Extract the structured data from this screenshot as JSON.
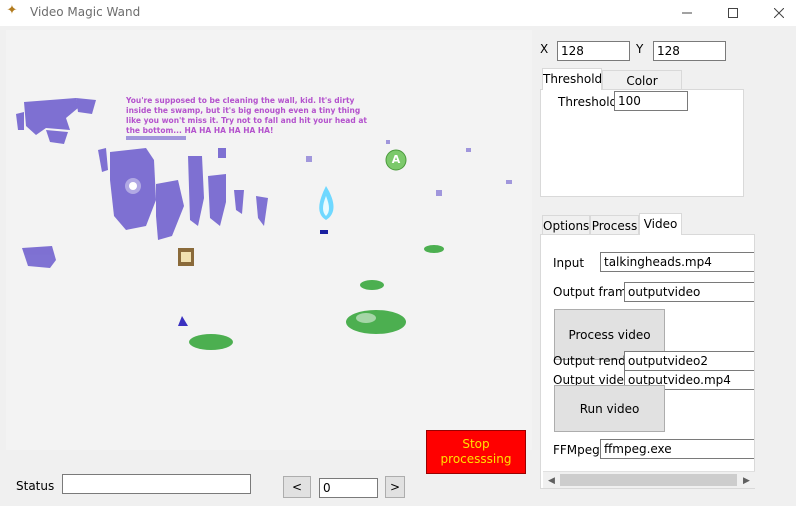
{
  "window": {
    "title": "Video Magic Wand"
  },
  "scene": {
    "speech_text": "You're supposed to be cleaning the wall, kid. It's dirty inside the swamp, but it's big enough even a tiny thing like you won't miss it. Try not to fall and hit your head at the bottom... HA HA HA HA HA HA!",
    "badge_letter": "A"
  },
  "coords": {
    "x_label": "X",
    "x_value": "128",
    "y_label": "Y",
    "y_value": "128"
  },
  "threshold_tabs": {
    "tab1": "Threshold",
    "tab2": "Color threshold",
    "field_label": "Threshold",
    "field_value": "100"
  },
  "options_tabs": {
    "tab1": "Options",
    "tab2": "Process",
    "tab3": "Video"
  },
  "video": {
    "input_label": "Input",
    "input_value": "talkingheads.mp4",
    "output_frames_label": "Output frames",
    "output_frames_value": "outputvideo",
    "process_button": "Process video",
    "output_render_label": "Output render",
    "output_render_value": "outputvideo2",
    "output_video_label": "Output video",
    "output_video_value": "outputvideo.mp4",
    "run_button": "Run video",
    "ffmpeg_label": "FFMpeg",
    "ffmpeg_value": "ffmpeg.exe"
  },
  "stop_button": {
    "line1": "Stop",
    "line2": "processsing"
  },
  "status": {
    "label": "Status",
    "value": ""
  },
  "frame_nav": {
    "prev": "<",
    "value": "0",
    "next": ">"
  },
  "colors": {
    "stop_bg": "#ff0000",
    "stop_text": "#ffe000",
    "silhouette": "#6a5acd",
    "speech": "#b452cd"
  }
}
